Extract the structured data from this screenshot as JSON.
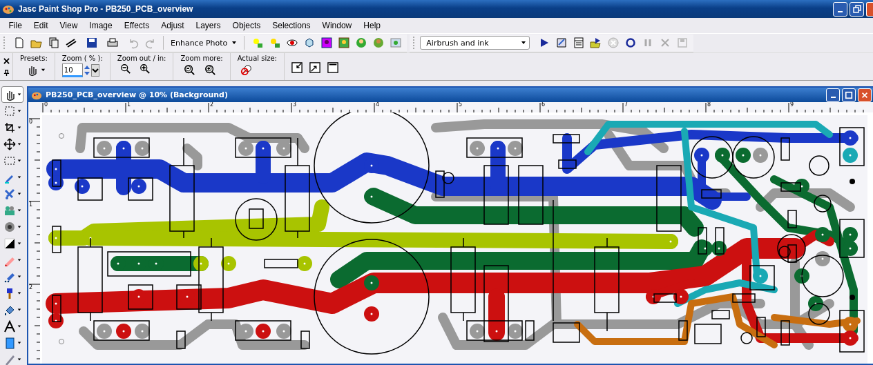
{
  "window": {
    "title": "Jasc Paint Shop Pro - PB250_PCB_overview"
  },
  "menu": [
    "File",
    "Edit",
    "View",
    "Image",
    "Effects",
    "Adjust",
    "Layers",
    "Objects",
    "Selections",
    "Window",
    "Help"
  ],
  "toolbar": {
    "enhance_photo": "Enhance Photo",
    "script_dropdown": "Airbrush and ink"
  },
  "tool_options": {
    "presets_label": "Presets:",
    "zoom_label": "Zoom ( % ):",
    "zoom_value": "10",
    "zoom_out_in_label": "Zoom out / in:",
    "zoom_more_label": "Zoom more:",
    "actual_size_label": "Actual size:"
  },
  "toolbox": [
    {
      "selected": true
    },
    {
      "selected": false
    },
    {
      "selected": false
    },
    {
      "selected": false
    },
    {
      "selected": false
    },
    {
      "selected": false
    },
    {
      "selected": false
    },
    {
      "selected": false
    },
    {
      "selected": false
    },
    {
      "selected": false
    },
    {
      "selected": false
    },
    {
      "selected": false
    },
    {
      "selected": false
    },
    {
      "selected": false
    },
    {
      "selected": false
    },
    {
      "selected": false
    },
    {
      "selected": false
    }
  ],
  "image_window": {
    "title": "PB250_PCB_overview @  10% (Background)",
    "ruler_horizontal": [
      "0",
      "1",
      "2",
      "3",
      "4",
      "5",
      "6",
      "7",
      "8",
      "9"
    ],
    "ruler_vertical": [
      "0",
      "1",
      "2"
    ]
  }
}
